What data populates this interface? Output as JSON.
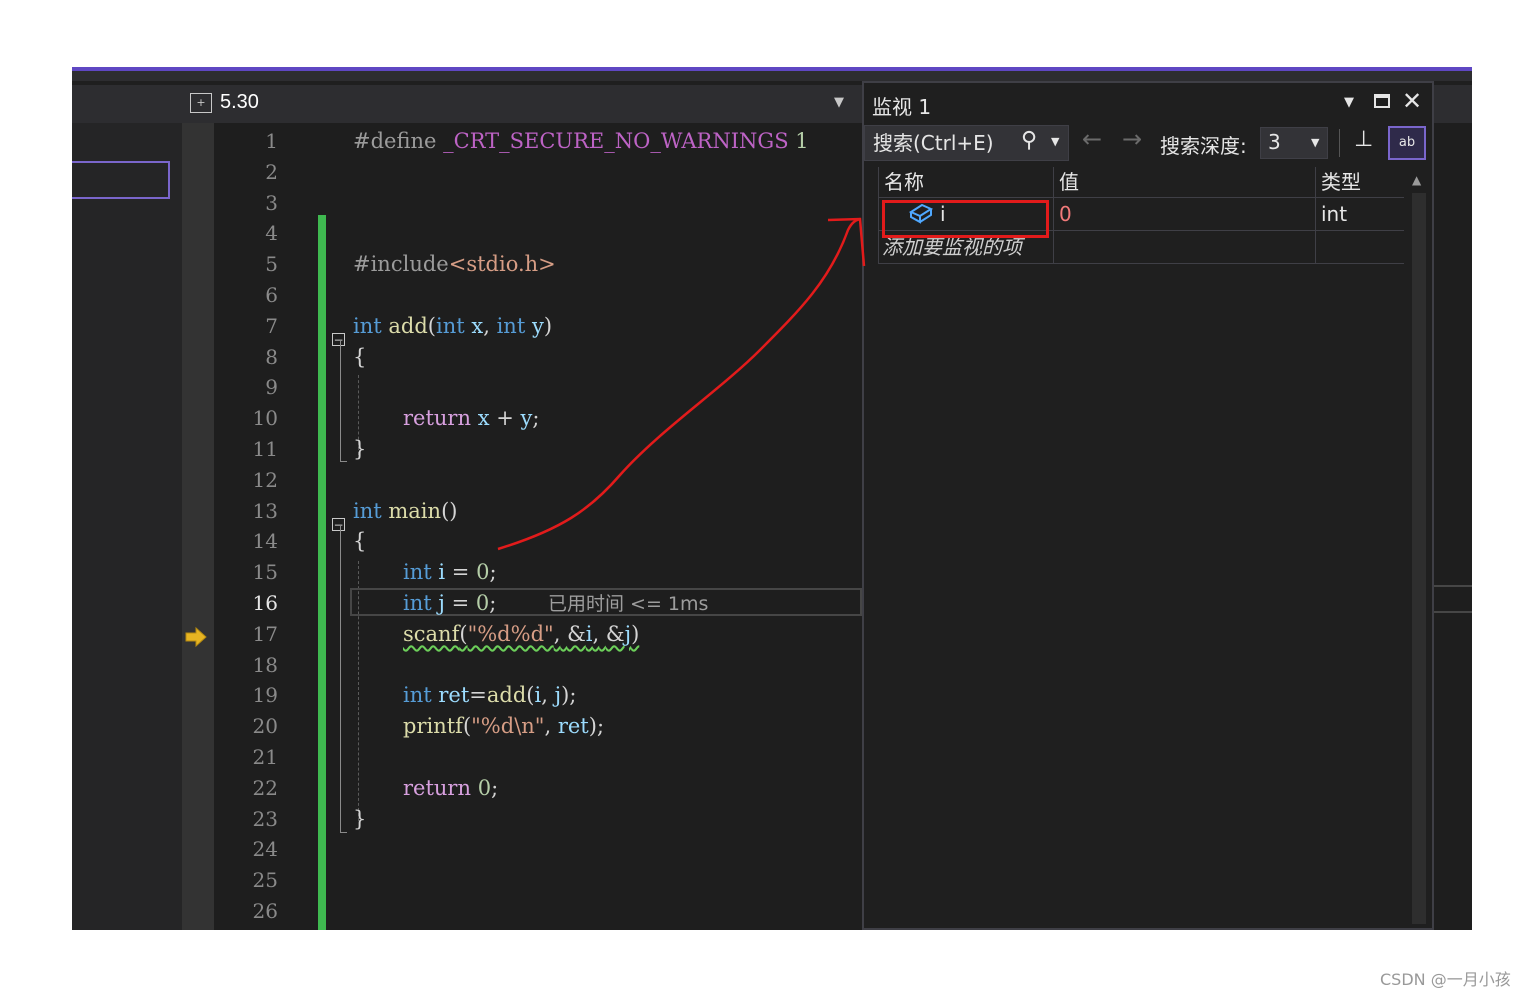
{
  "editor": {
    "tab_title": "5.30",
    "current_line": 16,
    "elapsed_hint": "已用时间 <= 1ms",
    "lines": [
      {
        "n": 1,
        "text": "#define _CRT_SECURE_NO_WARNINGS 1"
      },
      {
        "n": 2,
        "text": ""
      },
      {
        "n": 3,
        "text": ""
      },
      {
        "n": 4,
        "text": ""
      },
      {
        "n": 5,
        "text": "#include<stdio.h>"
      },
      {
        "n": 6,
        "text": ""
      },
      {
        "n": 7,
        "text": "int add(int x, int y)"
      },
      {
        "n": 8,
        "text": "{"
      },
      {
        "n": 9,
        "text": ""
      },
      {
        "n": 10,
        "text": "return x + y;"
      },
      {
        "n": 11,
        "text": "}"
      },
      {
        "n": 12,
        "text": ""
      },
      {
        "n": 13,
        "text": "int main()"
      },
      {
        "n": 14,
        "text": "{"
      },
      {
        "n": 15,
        "text": "int i = 0;"
      },
      {
        "n": 16,
        "text": "int j = 0;"
      },
      {
        "n": 17,
        "text": "scanf(\"%d%d\", &i, &j);"
      },
      {
        "n": 18,
        "text": ""
      },
      {
        "n": 19,
        "text": "int ret=add(i, j);"
      },
      {
        "n": 20,
        "text": "printf(\"%d\\n\", ret);"
      },
      {
        "n": 21,
        "text": ""
      },
      {
        "n": 22,
        "text": "return 0;"
      },
      {
        "n": 23,
        "text": "}"
      },
      {
        "n": 24,
        "text": ""
      },
      {
        "n": 25,
        "text": ""
      },
      {
        "n": 26,
        "text": ""
      }
    ]
  },
  "watch": {
    "title": "监视 1",
    "search_placeholder": "搜索(Ctrl+E)",
    "depth_label": "搜索深度:",
    "depth_value": "3",
    "columns": [
      "名称",
      "值",
      "类型"
    ],
    "rows": [
      {
        "name": "i",
        "value": "0",
        "type": "int"
      }
    ],
    "add_item_text": "添加要监视的项"
  },
  "icons": {
    "debug_arrow": "current-statement-arrow-icon",
    "search": "search-icon",
    "pin": "pin-icon",
    "hex": "hex-display-icon"
  },
  "colors": {
    "keyword": "#569cd6",
    "string": "#d69d85",
    "function": "#dcdcaa",
    "control": "#d8a0df",
    "change_bar": "#3fb950",
    "annotation": "#e21b1b",
    "accent": "#5f47c3"
  },
  "footer": {
    "credit": "CSDN @一月小孩"
  }
}
